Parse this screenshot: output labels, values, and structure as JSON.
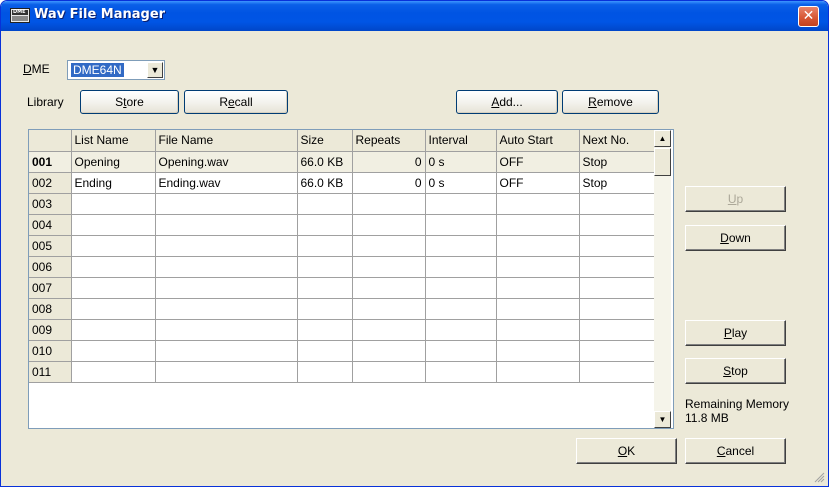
{
  "window": {
    "title": "Wav File Manager",
    "icon": "dme-app-icon",
    "close_glyph": "✕"
  },
  "dme": {
    "label": "DME",
    "selected": "DME64N",
    "arrow": "▼"
  },
  "library": {
    "label": "Library",
    "store": "Store",
    "recall": "Recall",
    "add": "Add...",
    "remove": "Remove"
  },
  "table": {
    "columns": [
      "",
      "List Name",
      "File Name",
      "Size",
      "Repeats",
      "Interval",
      "Auto Start",
      "Next No."
    ],
    "rows": [
      {
        "no": "001",
        "list_name": "Opening",
        "file_name": "Opening.wav",
        "size": "66.0 KB",
        "repeats": "0",
        "interval": "0 s",
        "auto_start": "OFF",
        "next_no": "Stop"
      },
      {
        "no": "002",
        "list_name": "Ending",
        "file_name": "Ending.wav",
        "size": "66.0 KB",
        "repeats": "0",
        "interval": "0 s",
        "auto_start": "OFF",
        "next_no": "Stop"
      },
      {
        "no": "003"
      },
      {
        "no": "004"
      },
      {
        "no": "005"
      },
      {
        "no": "006"
      },
      {
        "no": "007"
      },
      {
        "no": "008"
      },
      {
        "no": "009"
      },
      {
        "no": "010"
      },
      {
        "no": "011"
      }
    ],
    "scroll_up": "▲",
    "scroll_down": "▼"
  },
  "side": {
    "up": "Up",
    "down": "Down",
    "play": "Play",
    "stop": "Stop",
    "remaining_label": "Remaining Memory",
    "remaining_value": "11.8 MB"
  },
  "footer": {
    "ok": "OK",
    "cancel": "Cancel"
  }
}
